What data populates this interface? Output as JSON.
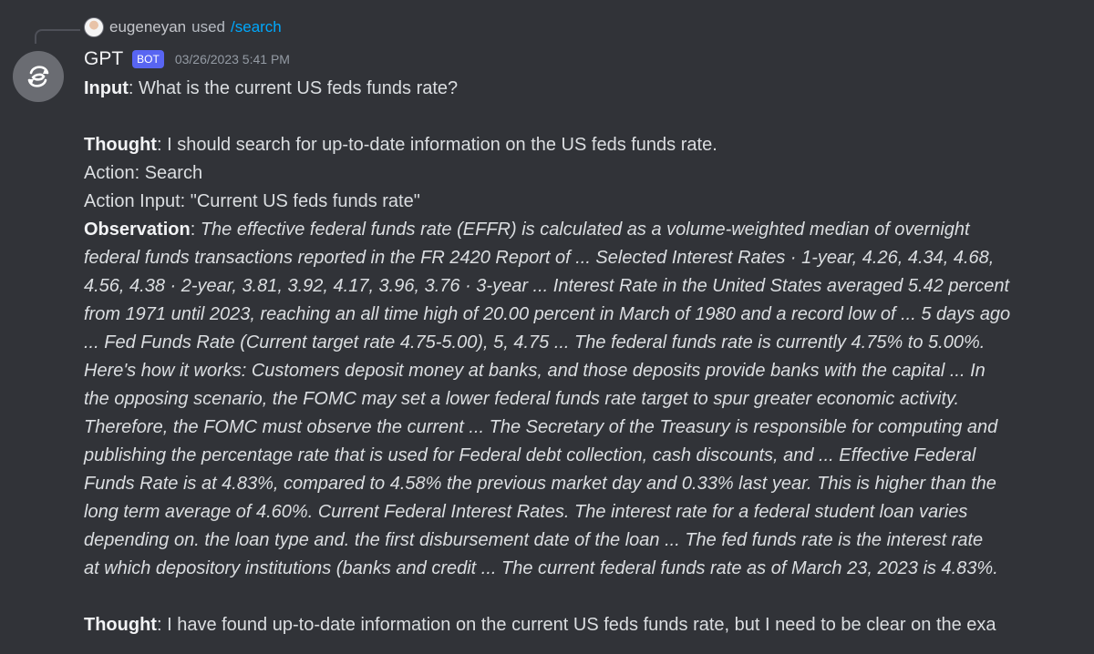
{
  "reply": {
    "username": "eugeneyan",
    "used_text": "used",
    "command": "/search"
  },
  "message": {
    "author": "GPT",
    "badge": "BOT",
    "timestamp": "03/26/2023 5:41 PM",
    "input_label": "Input",
    "input_text": ": What is the current US feds funds rate?",
    "thought1_label": "Thought",
    "thought1_text": ": I should search for up-to-date information on the US feds funds rate.",
    "action": "Action: Search",
    "action_input": "Action Input: \"Current US feds funds rate\"",
    "observation_label": "Observation",
    "observation_first": ": ",
    "observation_lines": [
      "The effective federal funds rate (EFFR) is calculated as a volume-weighted median of overnight",
      "federal funds transactions reported in the FR 2420 Report of ... Selected Interest Rates · 1-year, 4.26, 4.34, 4.68,",
      "4.56, 4.38 · 2-year, 3.81, 3.92, 4.17, 3.96, 3.76 · 3-year ... Interest Rate in the United States averaged 5.42 percent",
      "from 1971 until 2023, reaching an all time high of 20.00 percent in March of 1980 and a record low of ... 5 days ago",
      "... Fed Funds Rate (Current target rate 4.75-5.00), 5, 4.75 ... The federal funds rate is currently 4.75% to 5.00%.",
      "Here's how it works: Customers deposit money at banks, and those deposits provide banks with the capital ... In",
      "the opposing scenario, the FOMC may set a lower federal funds rate target to spur greater economic activity.",
      "Therefore, the FOMC must observe the current ... The Secretary of the Treasury is responsible for computing and",
      "publishing the percentage rate that is used for Federal debt collection, cash discounts, and ... Effective Federal",
      "Funds Rate is at 4.83%, compared to 4.58% the previous market day and 0.33% last year. This is higher than the",
      "long term average of 4.60%. Current Federal Interest Rates. The interest rate for a federal student loan varies",
      "depending on. the loan type and. the first disbursement date of the loan ... The fed funds rate is the interest rate",
      "at which depository institutions (banks and credit ... The current federal funds rate as of March 23, 2023 is 4.83%."
    ],
    "thought2_label": "Thought",
    "thought2_text": ": I have found up-to-date information on the current US feds funds rate, but I need to be clear on the exa"
  }
}
